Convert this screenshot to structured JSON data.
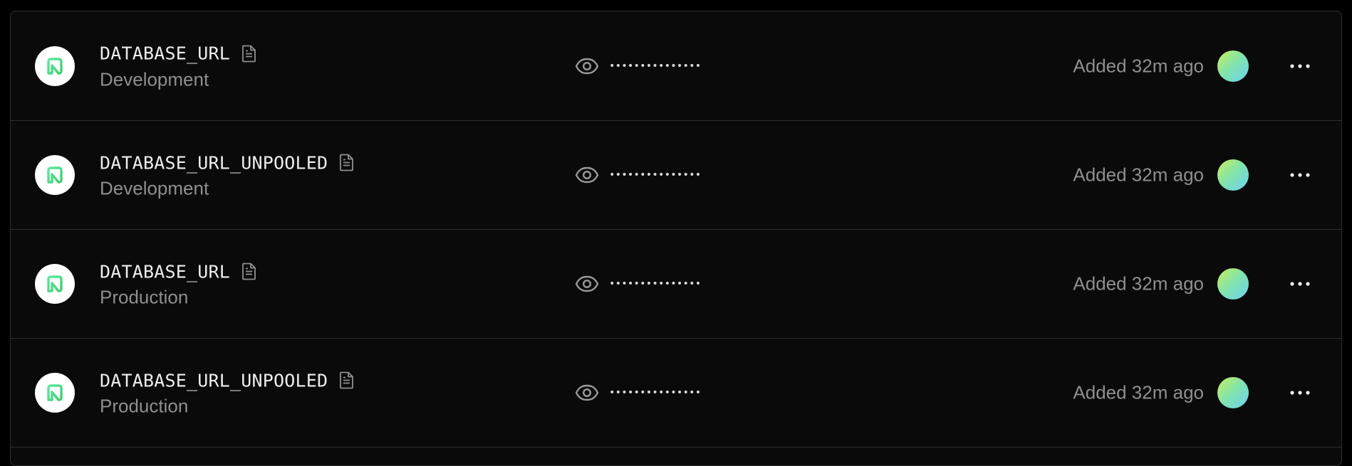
{
  "env_vars": [
    {
      "name": "DATABASE_URL",
      "environment": "Development",
      "masked_value": "•••••••••••••••",
      "added": "Added 32m ago"
    },
    {
      "name": "DATABASE_URL_UNPOOLED",
      "environment": "Development",
      "masked_value": "•••••••••••••••",
      "added": "Added 32m ago"
    },
    {
      "name": "DATABASE_URL",
      "environment": "Production",
      "masked_value": "•••••••••••••••",
      "added": "Added 32m ago"
    },
    {
      "name": "DATABASE_URL_UNPOOLED",
      "environment": "Production",
      "masked_value": "•••••••••••••••",
      "added": "Added 32m ago"
    }
  ],
  "icons": {
    "integration": "neon-logo-icon",
    "note": "file-text-icon",
    "reveal": "eye-icon",
    "menu": "more-horizontal-icon"
  },
  "colors": {
    "background": "#0a0a0a",
    "border": "#2e2e2e",
    "primary_text": "#ededed",
    "secondary_text": "#8f8f8f",
    "logo_accent": "#4ade80"
  }
}
